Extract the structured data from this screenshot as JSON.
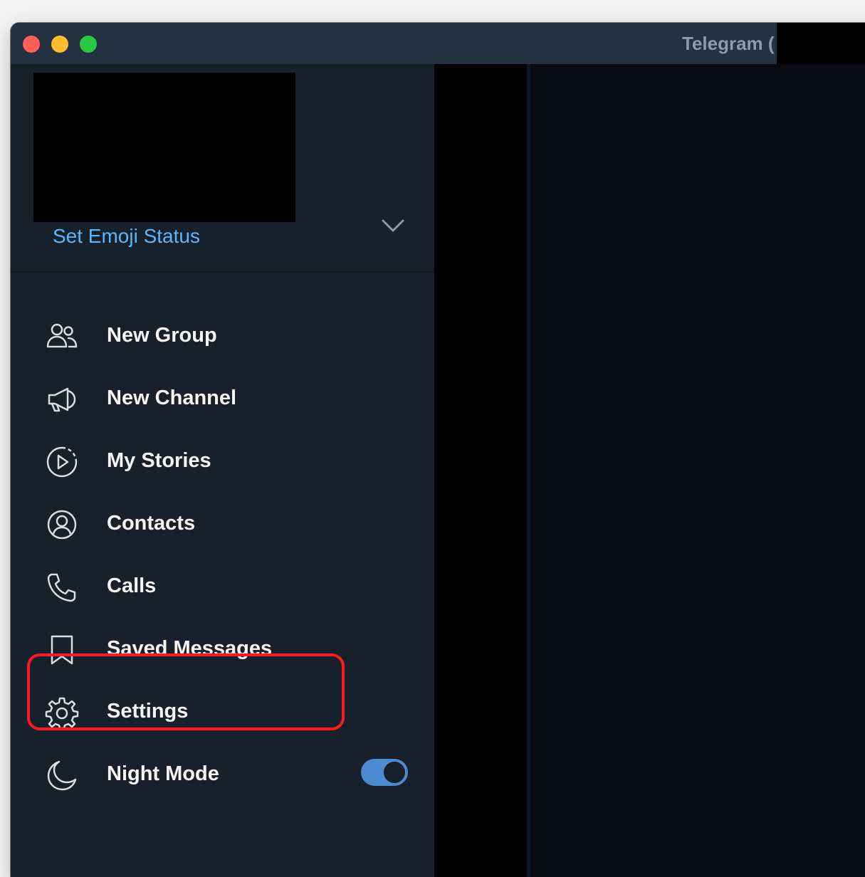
{
  "window": {
    "title": "Telegram ("
  },
  "profile": {
    "emoji_status": "Set Emoji Status"
  },
  "menu": {
    "items": [
      {
        "key": "new-group",
        "label": "New Group",
        "icon": "people-icon"
      },
      {
        "key": "new-channel",
        "label": "New Channel",
        "icon": "megaphone-icon"
      },
      {
        "key": "my-stories",
        "label": "My Stories",
        "icon": "stories-play-icon"
      },
      {
        "key": "contacts",
        "label": "Contacts",
        "icon": "contact-circle-icon"
      },
      {
        "key": "calls",
        "label": "Calls",
        "icon": "phone-icon"
      },
      {
        "key": "saved-messages",
        "label": "Saved Messages",
        "icon": "bookmark-icon"
      },
      {
        "key": "settings",
        "label": "Settings",
        "icon": "gear-icon"
      },
      {
        "key": "night-mode",
        "label": "Night Mode",
        "icon": "moon-icon"
      }
    ],
    "night_mode_enabled": true
  },
  "colors": {
    "sidebar_bg": "#17212b",
    "titlebar_bg": "#243140",
    "accent": "#5eb5f7",
    "toggle": "#4d8bd1",
    "highlight": "#ff1b1b",
    "text": "#f5f5f5"
  }
}
